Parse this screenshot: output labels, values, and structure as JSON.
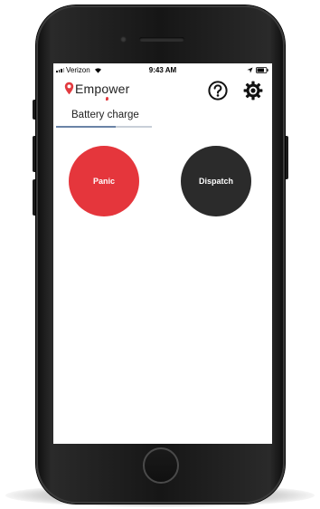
{
  "status_bar": {
    "carrier": "Verizon",
    "time": "9:43 AM",
    "icons": [
      "signal-bars-icon",
      "wifi-icon",
      "location-arrow-icon",
      "battery-icon"
    ]
  },
  "app": {
    "logo_text": "Empower",
    "brand_color": "#e5363c",
    "header_icons": [
      "help-icon",
      "gear-icon"
    ]
  },
  "tabs": [
    {
      "label": "Battery charge",
      "progress": 0.62
    }
  ],
  "actions": {
    "panic_label": "Panic",
    "panic_color": "#e5363c",
    "dispatch_label": "Dispatch",
    "dispatch_color": "#2b2b2b"
  }
}
